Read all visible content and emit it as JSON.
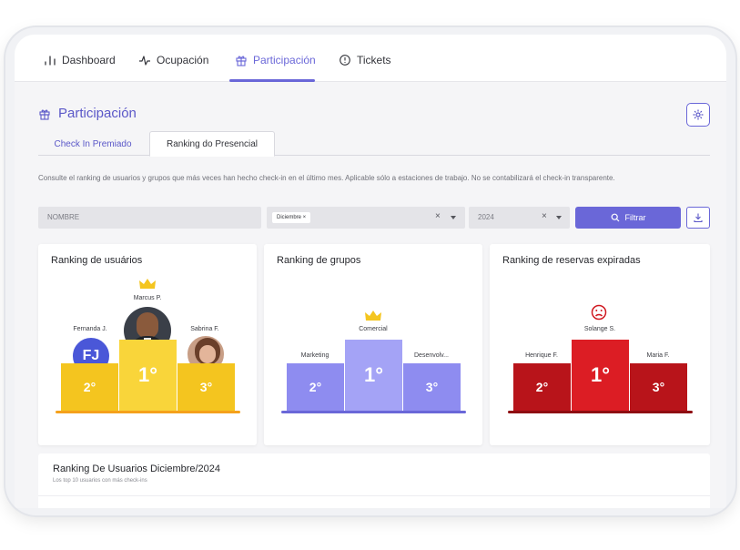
{
  "nav": {
    "tabs": [
      {
        "label": "Dashboard",
        "icon": "bar-chart-icon"
      },
      {
        "label": "Ocupación",
        "icon": "activity-icon"
      },
      {
        "label": "Participación",
        "icon": "gift-icon"
      },
      {
        "label": "Tickets",
        "icon": "clock-icon"
      }
    ],
    "active": "Participación"
  },
  "page": {
    "title": "Participación",
    "subtabs": [
      "Check In Premiado",
      "Ranking do  Presencial"
    ],
    "description": "Consulte el ranking de usuarios y grupos que más veces han hecho check-in en el último mes. Aplicable sólo a estaciones de trabajo. No se contabilizará el check-in transparente."
  },
  "filters": {
    "name_placeholder": "NOMBRE",
    "month_chip": "Diciembre ×",
    "year_value": "2024",
    "clear": "×",
    "filter_button": "Filtrar"
  },
  "cards": [
    {
      "title": "Ranking de usuários",
      "first": "Marcus P.",
      "second": "Fernanda J.",
      "third": "Sabrina F.",
      "second_initials": "FJ",
      "places": [
        "1°",
        "2°",
        "3°"
      ],
      "color": "#f4c51f"
    },
    {
      "title": "Ranking de grupos",
      "first": "Comercial",
      "second": "Marketing",
      "third": "Desenvolv...",
      "places": [
        "1°",
        "2°",
        "3°"
      ],
      "color": "#8e8cf0"
    },
    {
      "title": "Ranking de reservas expiradas",
      "first": "Solange S.",
      "second": "Henrique F.",
      "third": "Maria F.",
      "places": [
        "1°",
        "2°",
        "3°"
      ],
      "color": "#d01820"
    }
  ],
  "bottom": {
    "title": "Ranking De Usuarios Diciembre/2024",
    "subtitle": "Los top 10 usuarios con más check-ins"
  }
}
